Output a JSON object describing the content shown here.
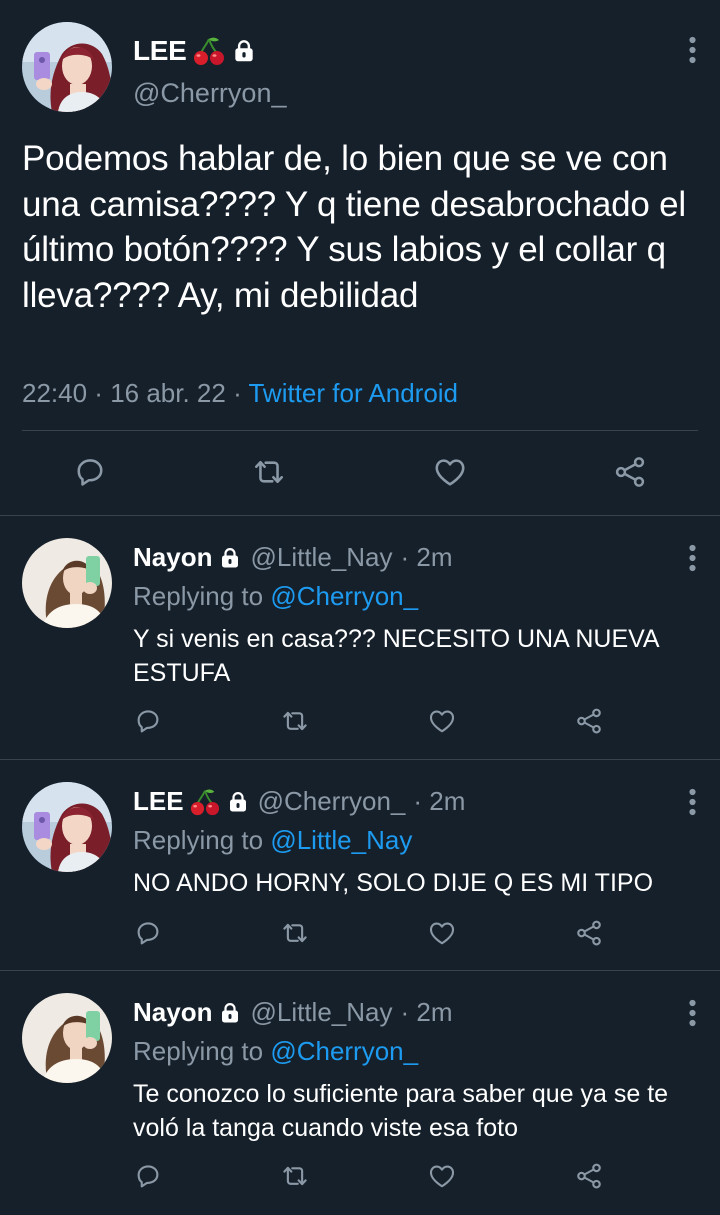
{
  "main_tweet": {
    "name": "LEE",
    "name_emoji": "🍒",
    "handle": "@Cherryon_",
    "text": "Podemos hablar de, lo bien que se ve con una camisa???? Y q tiene desabrochado el último botón???? Y sus labios y el collar q lleva???? Ay, mi debilidad",
    "time": "22:40",
    "separator": " · ",
    "date": "16 abr. 22",
    "source": "Twitter for Android"
  },
  "replies": [
    {
      "name": "Nayon",
      "handle": "@Little_Nay",
      "age": "· 2m",
      "replying_label": "Replying to",
      "replying_to": "@Cherryon_",
      "text": "Y si venis en casa??? NECESITO UNA NUEVA ESTUFA"
    },
    {
      "name": "LEE",
      "name_emoji": "🍒",
      "handle": "@Cherryon_",
      "age": "· 2m",
      "replying_label": "Replying to",
      "replying_to": "@Little_Nay",
      "text": "NO ANDO HORNY, SOLO DIJE Q ES MI TIPO"
    },
    {
      "name": "Nayon",
      "handle": "@Little_Nay",
      "age": "· 2m",
      "replying_label": "Replying to",
      "replying_to": "@Cherryon_",
      "text": "Te conozco lo suficiente para saber que ya se te voló la tanga cuando viste esa foto"
    }
  ],
  "icons": [
    "comment-icon",
    "retweet-icon",
    "like-icon",
    "share-icon",
    "more-options-icon",
    "lock-icon",
    "cherry-icon"
  ],
  "colors": {
    "background": "#15202b",
    "text": "#ffffff",
    "muted": "#8b98a5",
    "link": "#1d9bf0",
    "divider": "#38444d"
  }
}
